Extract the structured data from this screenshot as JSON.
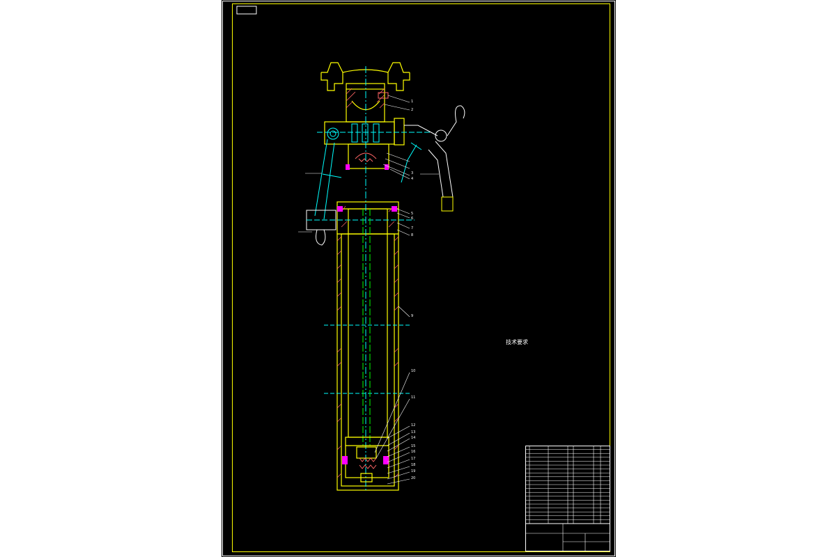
{
  "drawing": {
    "stamp_label": "",
    "callouts": {
      "top_handle": "",
      "side_handle": "",
      "left_lever": "",
      "left_hinge": "",
      "right_lower": "",
      "bolt_note": "",
      "part_numbers_upper": [
        "1",
        "2",
        "",
        "",
        "3",
        "4",
        "5",
        "6",
        "7",
        "8",
        "9",
        "10"
      ],
      "part_numbers_lower": [
        "11",
        "12",
        "13",
        "14",
        "15",
        "16",
        "17",
        "18",
        "19",
        "20",
        "21"
      ]
    },
    "technical_requirements": {
      "heading": "技术要求",
      "lines": [
        "",
        "",
        "",
        "",
        ""
      ]
    },
    "title_block": {
      "drawing_name": "",
      "drawing_code": "",
      "part_rows": [
        "",
        "",
        "",
        "",
        "",
        "",
        "",
        "",
        "",
        "",
        "",
        "",
        "",
        "",
        "",
        "",
        "",
        "",
        "",
        ""
      ]
    }
  },
  "colors": {
    "sheet": "#000000",
    "outline": "#ffffff",
    "structure": "#ffff00",
    "centerline": "#00ffff",
    "seal": "#ff00ff",
    "hatch": "#ff6666",
    "leader": "#ffffff"
  }
}
